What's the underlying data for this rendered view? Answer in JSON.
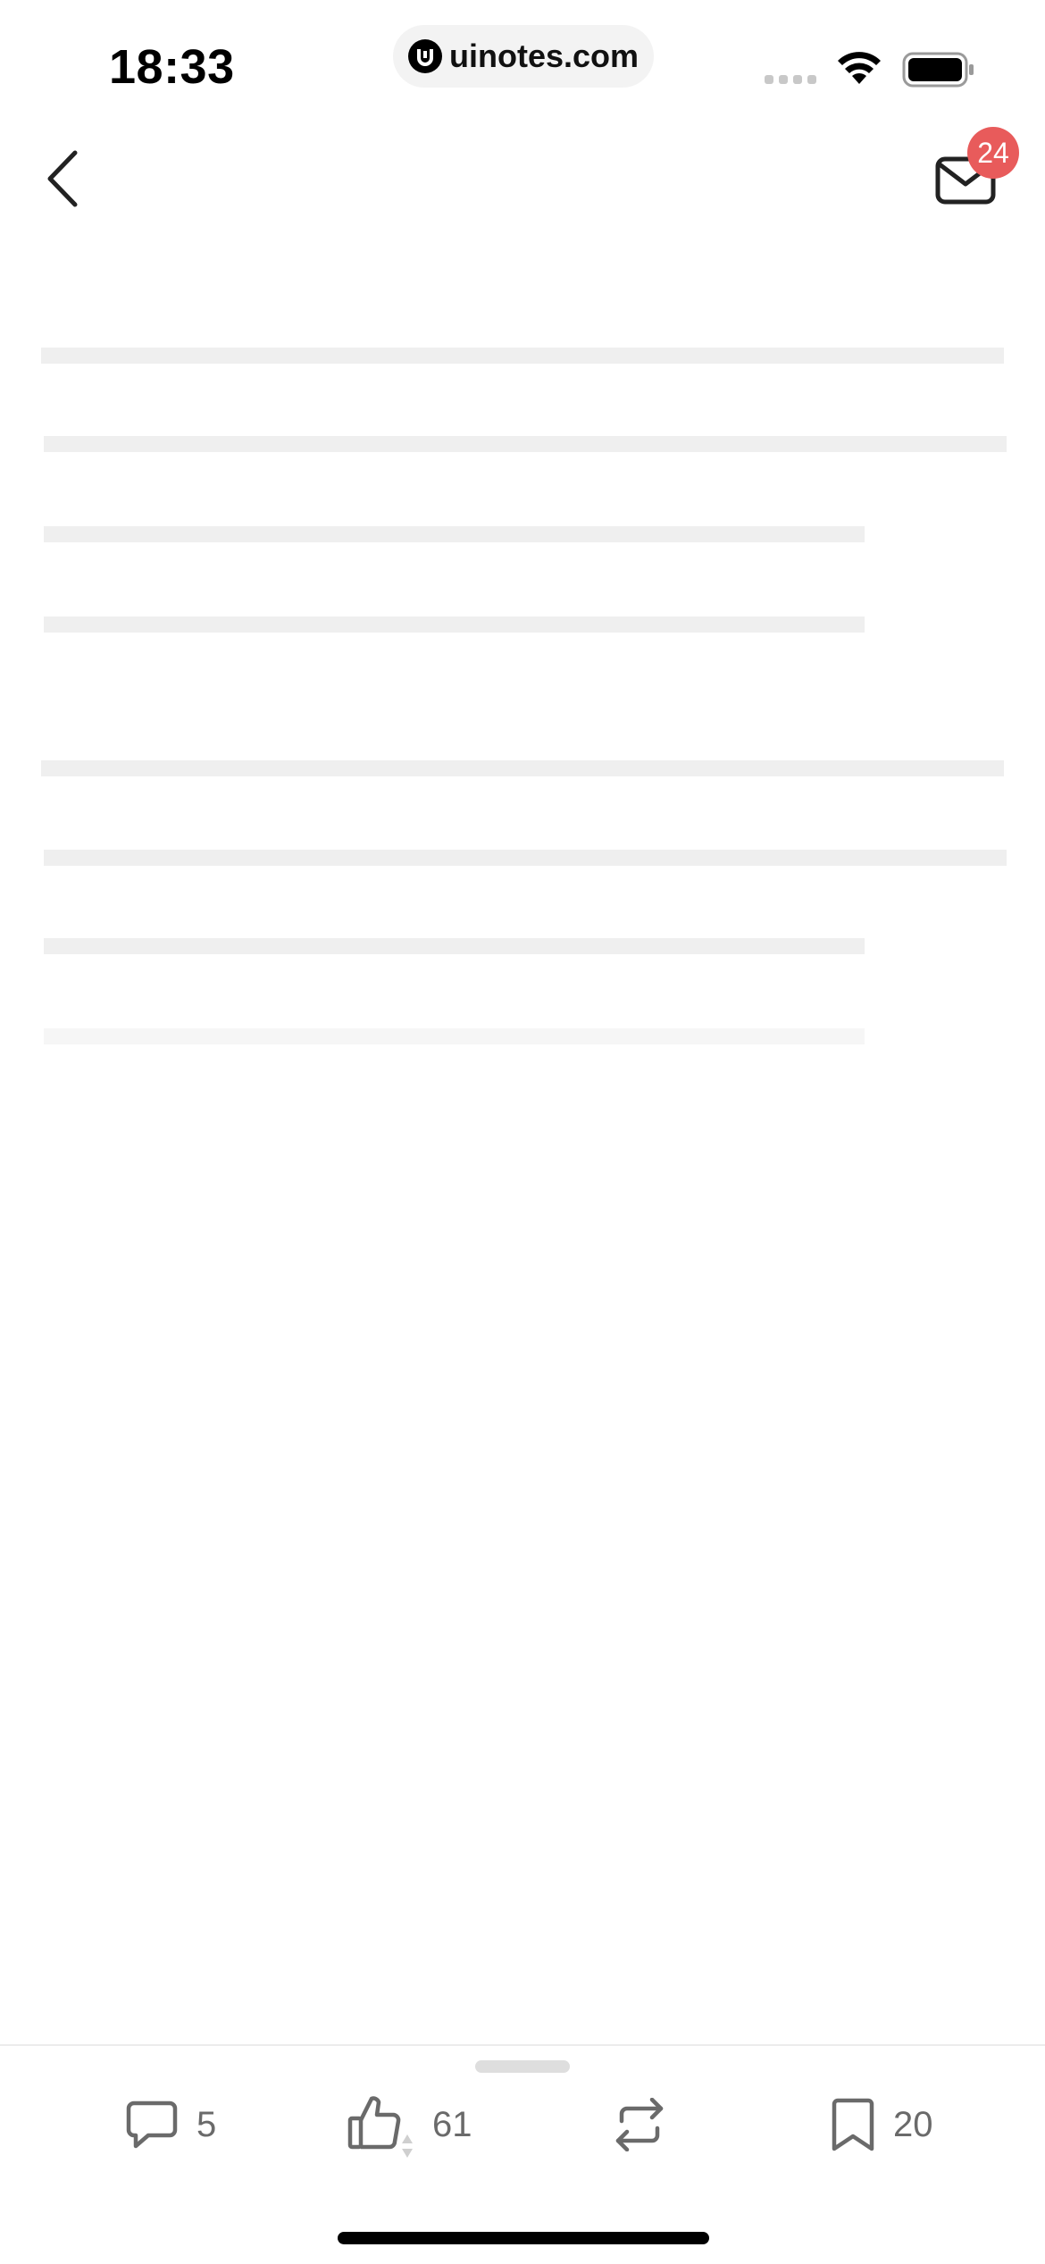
{
  "status_bar": {
    "time": "18:33",
    "url": "uinotes.com"
  },
  "header": {
    "back_icon": "chevron-left-icon",
    "mail_icon": "envelope-icon",
    "mail_badge_count": "24",
    "badge_color": "#e85b5b"
  },
  "content": {
    "state": "loading-skeleton",
    "skeleton_line_count": 8
  },
  "actions": {
    "comment": {
      "icon": "comment-icon",
      "count": "5"
    },
    "like": {
      "icon": "thumbs-up-icon",
      "count": "61"
    },
    "repost": {
      "icon": "repost-icon",
      "count": ""
    },
    "bookmark": {
      "icon": "bookmark-icon",
      "count": "20"
    }
  }
}
